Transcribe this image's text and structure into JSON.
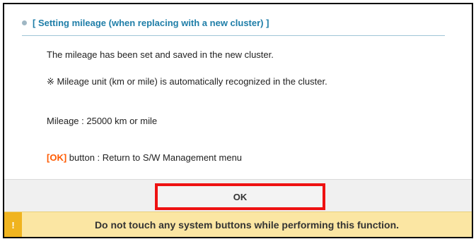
{
  "dialog": {
    "section_title": "[ Setting mileage (when replacing with a new cluster) ]",
    "message_saved": "The mileage has been set and saved in the new cluster.",
    "note": "※ Mileage unit (km or mile) is automatically recognized in the cluster.",
    "mileage_line": "Mileage : 25000 km or mile",
    "ok_hint_label": "[OK]",
    "ok_hint_text": " button : Return to S/W Management menu",
    "ok_button_label": "OK"
  },
  "warning": {
    "icon_text": "!",
    "text": "Do not touch any system buttons while performing this function."
  },
  "colors": {
    "title": "#1f7ea8",
    "ok_inline": "#ff5a00",
    "highlight_border": "#ee1111",
    "warning_background": "#fbe6a3",
    "warning_icon": "#f0b41f"
  }
}
